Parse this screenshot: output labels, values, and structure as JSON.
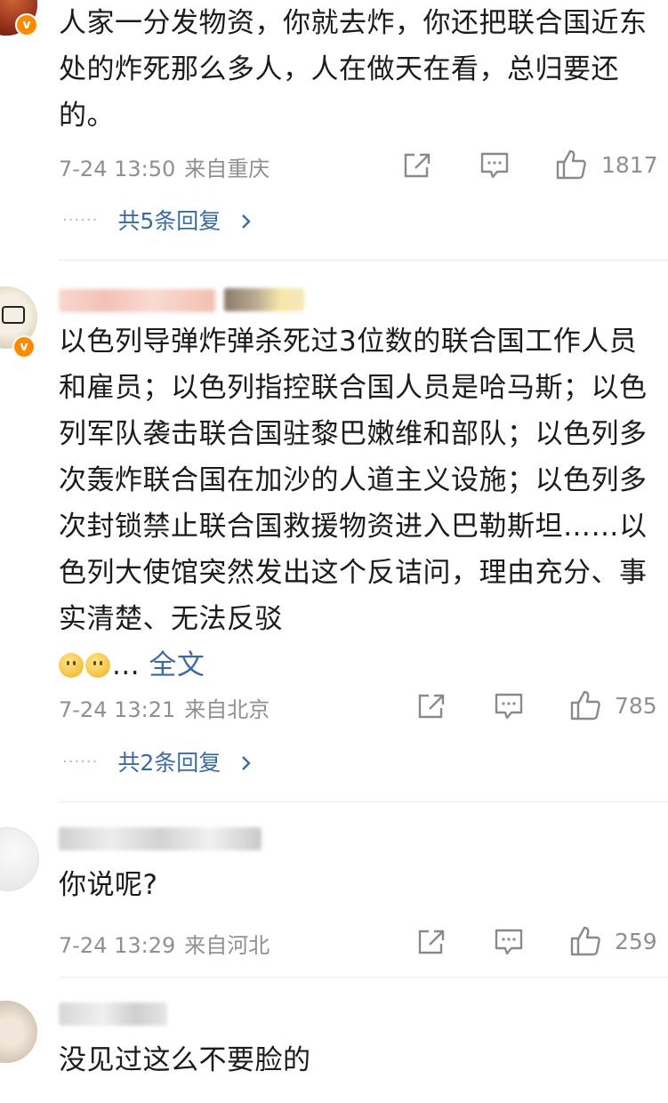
{
  "comments": [
    {
      "text": "人家一分发物资，你就去炸，你还把联合国近东处的炸死那么多人，人在做天在看，总归要还的。",
      "time": "7-24 13:50",
      "location": "来自重庆",
      "likes": "1817",
      "replies": "共5条回复"
    },
    {
      "text": "以色列导弹炸弹杀死过3位数的联合国工作人员和雇员；以色列指控联合国人员是哈马斯；以色列军队袭击联合国驻黎巴嫩维和部队；以色列多次轰炸联合国在加沙的人道主义设施；以色列多次封锁禁止联合国救援物资进入巴勒斯坦……以色列大使馆突然发出这个反诘问，理由充分、事实清楚、无法反驳",
      "tail": "...",
      "full_text_link": "全文",
      "time": "7-24 13:21",
      "location": "来自北京",
      "likes": "785",
      "replies": "共2条回复"
    },
    {
      "text": "你说呢?",
      "time": "7-24 13:29",
      "location": "来自河北",
      "likes": "259"
    },
    {
      "text": "没见过这么不要脸的"
    }
  ],
  "icons": {
    "share": "share-icon",
    "comment": "comment-icon",
    "like": "like-icon",
    "chevron": "chevron-right-icon",
    "verified": "verified-badge-icon"
  },
  "colors": {
    "link": "#3b6aa3",
    "meta": "#8f8f8f",
    "badge": "#ff8a00"
  }
}
